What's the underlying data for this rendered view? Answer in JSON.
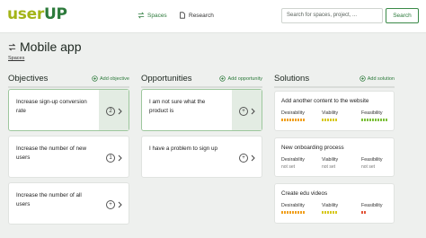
{
  "app": {
    "logo_part1": "user",
    "logo_part2": "UP"
  },
  "nav": [
    {
      "label": "Spaces",
      "icon": "swap-icon"
    },
    {
      "label": "Research",
      "icon": "document-icon"
    }
  ],
  "search": {
    "placeholder": "Search for spaces, project, ...",
    "button": "Search"
  },
  "page": {
    "title": "Mobile app",
    "icon": "swap-icon",
    "breadcrumb": "Spaces"
  },
  "columns": [
    {
      "title": "Objectives",
      "add_label": "Add objective"
    },
    {
      "title": "Opportunities",
      "add_label": "Add opportunity"
    },
    {
      "title": "Solutions",
      "add_label": "Add solution"
    }
  ],
  "objectives": [
    {
      "text": "Increase sign-up conversion rate",
      "badge": "2",
      "selected": true
    },
    {
      "text": "Increase the number of new users",
      "badge": "1",
      "selected": false
    },
    {
      "text": "Increase the number of all users",
      "badge": "+",
      "selected": false
    }
  ],
  "opportunities": [
    {
      "text": "I am not sure what the product is",
      "badge": "+",
      "selected": true
    },
    {
      "text": "I have a problem to sign up",
      "badge": "+",
      "selected": false
    }
  ],
  "solutions": [
    {
      "title": "Add another content to the website",
      "desirability": "",
      "viability": "",
      "feasibility": ""
    },
    {
      "title": "New onboarding process",
      "desirability": "not set",
      "viability": "not set",
      "feasibility": "not set"
    },
    {
      "title": "Create edu videos",
      "desirability": "",
      "viability": "",
      "feasibility": ""
    }
  ],
  "metric_labels": {
    "desirability": "Desirability",
    "viability": "Viability",
    "feasibility": "Feasibility"
  },
  "colors": {
    "brand_green": "#2c7a3b",
    "brand_lime": "#a3b418",
    "bar_orange": "#f0a020",
    "bar_yellow": "#d7c81e",
    "bar_green": "#7cc03a",
    "bar_red": "#e2553a"
  }
}
